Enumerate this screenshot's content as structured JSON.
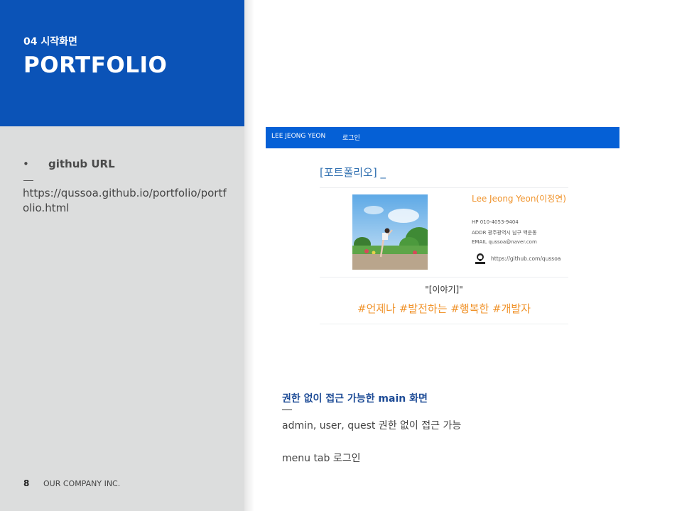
{
  "slide": {
    "subtitle": "04 시작화면",
    "title": "PORTFOLIO",
    "bullet_symbol": "•",
    "bullet_label": "github URL",
    "url": "https://qussoa.github.io/portfolio/portfolio.html",
    "page_number": "8",
    "company": "OUR COMPANY INC."
  },
  "screenshot": {
    "nav": {
      "brand": "LEE JEONG YEON",
      "login": "로그인"
    },
    "portfolio_title": "[포트폴리오] _",
    "profile": {
      "name": "Lee Jeong Yeon(이정연)",
      "hp": "HP 010-4053-9404",
      "addr": "ADDR 광주광역시 남구 백운동",
      "email": "EMAIL qussoa@naver.com",
      "github_url": "https://github.com/qussoa"
    },
    "story_title": "\"[이야기]\"",
    "story_tags": "#언제나 #발전하는 #행복한 #개발자"
  },
  "description": {
    "heading": "권한 없이 접근 가능한 main 화면",
    "line1": "admin, user, quest 권한 없이 접근 가능",
    "line2": "menu tab 로그인"
  },
  "colors": {
    "brand_blue": "#0b53b7",
    "nav_blue": "#0560d6",
    "accent_orange": "#f0932b",
    "panel_gray": "#dcdddd"
  },
  "icons": {
    "github": "github-icon"
  }
}
